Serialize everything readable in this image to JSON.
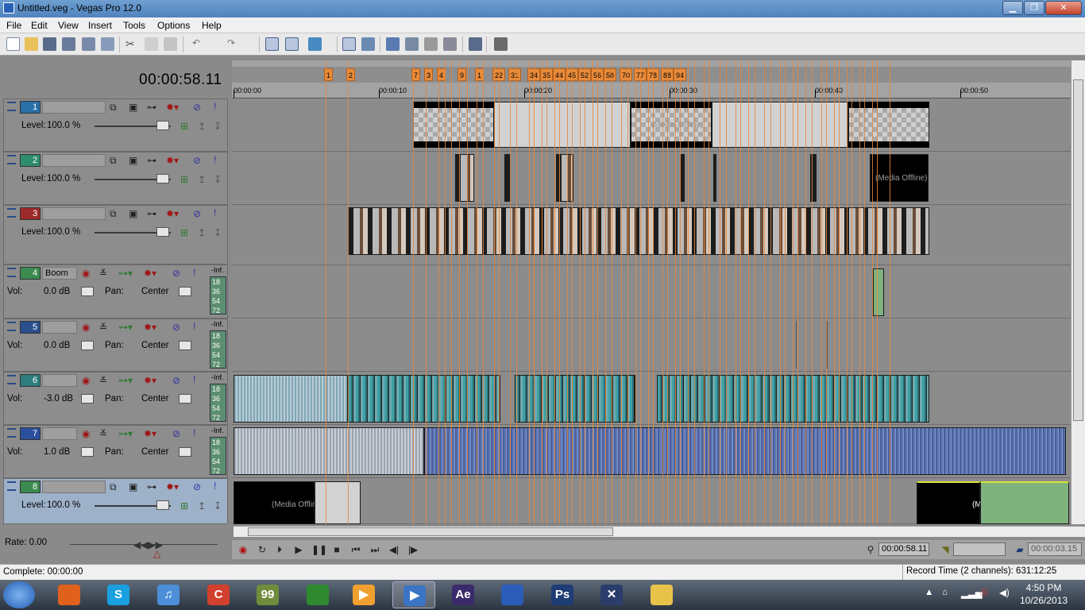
{
  "window": {
    "title": "Untitled.veg - Vegas Pro 12.0",
    "minimize": "▁",
    "restore": "❐",
    "close": "✕"
  },
  "menu": [
    "File",
    "Edit",
    "View",
    "Insert",
    "Tools",
    "Options",
    "Help"
  ],
  "time_display": "00:00:58.11",
  "tracks": [
    {
      "number": "1",
      "type": "video",
      "level_label": "Level:",
      "level": "100.0 %",
      "color": "#2a6fa8"
    },
    {
      "number": "2",
      "type": "video",
      "level_label": "Level:",
      "level": "100.0 %",
      "color": "#2f8c6f"
    },
    {
      "number": "3",
      "type": "video",
      "level_label": "Level:",
      "level": "100.0 %",
      "color": "#9c2a2a"
    },
    {
      "number": "4",
      "type": "audio",
      "name": "Boom",
      "vol_label": "Vol:",
      "vol": "0.0 dB",
      "pan_label": "Pan:",
      "pan": "Center",
      "meter_top": "-Inf.",
      "meter": [
        "18",
        "36",
        "54",
        "72"
      ],
      "color": "#3b8a4f"
    },
    {
      "number": "5",
      "type": "audio",
      "name": "",
      "vol_label": "Vol:",
      "vol": "0.0 dB",
      "pan_label": "Pan:",
      "pan": "Center",
      "meter_top": "-Inf.",
      "meter": [
        "18",
        "36",
        "54",
        "72"
      ],
      "color": "#2a4f8c"
    },
    {
      "number": "6",
      "type": "audio",
      "name": "",
      "vol_label": "Vol:",
      "vol": "-3.0 dB",
      "pan_label": "Pan:",
      "pan": "Center",
      "meter_top": "-Inf.",
      "meter": [
        "18",
        "36",
        "54",
        "72"
      ],
      "color": "#2e7d7d"
    },
    {
      "number": "7",
      "type": "audio",
      "name": "",
      "vol_label": "Vol:",
      "vol": "1.0 dB",
      "pan_label": "Pan:",
      "pan": "Center",
      "meter_top": "-Inf.",
      "meter": [
        "18",
        "36",
        "54",
        "72"
      ],
      "color": "#2a4f9c"
    },
    {
      "number": "8",
      "type": "video",
      "level_label": "Level:",
      "level": "100.0 %",
      "color": "#3b8a4f"
    }
  ],
  "ruler": {
    "ticks": [
      "00:00:00",
      "00:00:10",
      "00:00:20",
      "00:00:30",
      "00:00:40",
      "00:00:50"
    ],
    "markers": [
      "1",
      "2",
      "7",
      "3",
      "4",
      "9",
      "1",
      "22",
      "31",
      "34",
      "35",
      "44",
      "45",
      "52",
      "56",
      "58",
      "70",
      "77",
      "78",
      "88",
      "94"
    ]
  },
  "clip_labels": {
    "offline": "(Media Offline)"
  },
  "rate": {
    "label": "Rate: 0.00"
  },
  "transport": {
    "cursor_time": "00:00:58.11",
    "selection_end": "",
    "selection_length": "00:00:03.15"
  },
  "status": {
    "left": "Complete: 00:00:00",
    "right": "Record Time (2 channels): 631:12:25"
  },
  "taskbar": {
    "apps": [
      {
        "name": "firefox",
        "color": "#e0611c",
        "glyph": ""
      },
      {
        "name": "skype",
        "color": "#1aa0e0",
        "glyph": "S"
      },
      {
        "name": "itunes",
        "color": "#4c8fd8",
        "glyph": "♫"
      },
      {
        "name": "ccleaner",
        "color": "#d2402e",
        "glyph": "C"
      },
      {
        "name": "app-99",
        "color": "#6f8d3b",
        "glyph": "99"
      },
      {
        "name": "green-app",
        "color": "#2f8a2f",
        "glyph": ""
      },
      {
        "name": "media-player",
        "color": "#f0a030",
        "glyph": "▶"
      },
      {
        "name": "vegas",
        "color": "#3b74c4",
        "glyph": "▶"
      },
      {
        "name": "after-effects",
        "color": "#3a2a6b",
        "glyph": "Ae"
      },
      {
        "name": "blue-globe",
        "color": "#2a5cb8",
        "glyph": ""
      },
      {
        "name": "photoshop",
        "color": "#1e3c75",
        "glyph": "Ps"
      },
      {
        "name": "x-app",
        "color": "#2a3d6b",
        "glyph": "✕"
      },
      {
        "name": "explorer",
        "color": "#e8c34a",
        "glyph": ""
      }
    ],
    "time": "4:50 PM",
    "date": "10/26/2013"
  },
  "colors": {
    "marker": "#e88b3a",
    "selection": "#9db1c9",
    "video_level_bar": "#3a3a3a"
  }
}
